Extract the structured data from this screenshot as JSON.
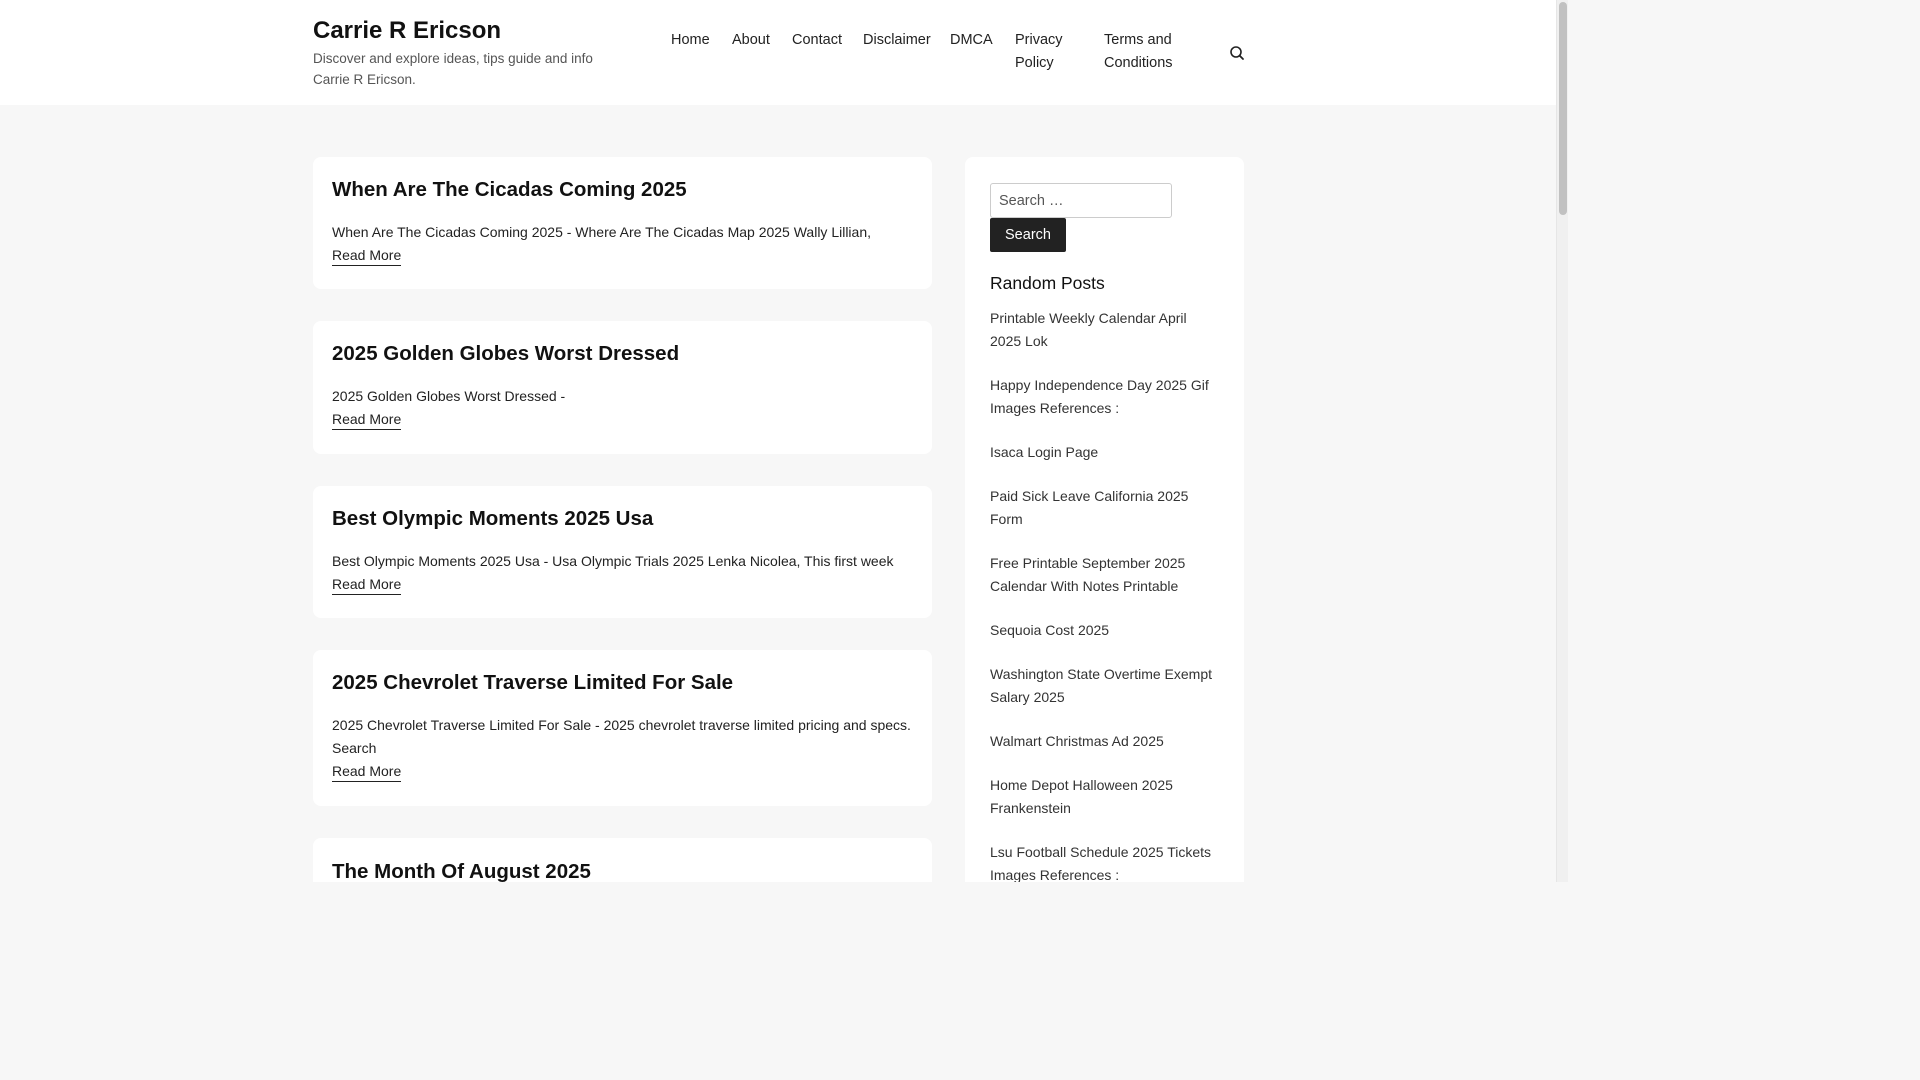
{
  "header": {
    "title": "Carrie R Ericson",
    "description": "Discover and explore ideas, tips guide and info Carrie R Ericson."
  },
  "nav": {
    "items": [
      {
        "label": "Home"
      },
      {
        "label": "About"
      },
      {
        "label": "Contact"
      },
      {
        "label": "Disclaimer"
      },
      {
        "label": "DMCA"
      },
      {
        "label": "Privacy Policy"
      },
      {
        "label": "Terms and Conditions"
      }
    ],
    "search_icon": "search-icon"
  },
  "posts": [
    {
      "title": "When Are The Cicadas Coming 2025",
      "excerpt": "When Are The Cicadas Coming 2025 - Where Are The Cicadas Map 2025 Wally Lillian,",
      "more": "Read More"
    },
    {
      "title": "2025 Golden Globes Worst Dressed",
      "excerpt": "2025 Golden Globes Worst Dressed -",
      "more": "Read More"
    },
    {
      "title": "Best Olympic Moments 2025 Usa",
      "excerpt": "Best Olympic Moments 2025 Usa - Usa Olympic Trials 2025 Lenka Nicolea, This first week",
      "more": "Read More"
    },
    {
      "title": "2025 Chevrolet Traverse Limited For Sale",
      "excerpt": "2025 Chevrolet Traverse Limited For Sale - 2025 chevrolet traverse limited pricing and specs. Search",
      "more": "Read More"
    },
    {
      "title": "The Month Of August 2025",
      "excerpt": "",
      "more": ""
    }
  ],
  "sidebar": {
    "search_placeholder": "Search …",
    "search_button": "Search",
    "random_title": "Random Posts",
    "random_posts": [
      "Printable Weekly Calendar April 2025 Lok",
      "Happy Independence Day 2025 Gif Images References :",
      "Isaca Login Page",
      "Paid Sick Leave California 2025 Form",
      "Free Printable September 2025 Calendar With Notes Printable",
      "Sequoia Cost 2025",
      "Washington State Overtime Exempt Salary 2025",
      "Walmart Christmas Ad 2025",
      "Home Depot Halloween 2025 Frankenstein",
      "Lsu Football Schedule 2025 Tickets Images References :"
    ]
  },
  "colors": {
    "page_bg": "#f7f7f7",
    "card_bg": "#ffffff",
    "button_bg": "#222222"
  }
}
